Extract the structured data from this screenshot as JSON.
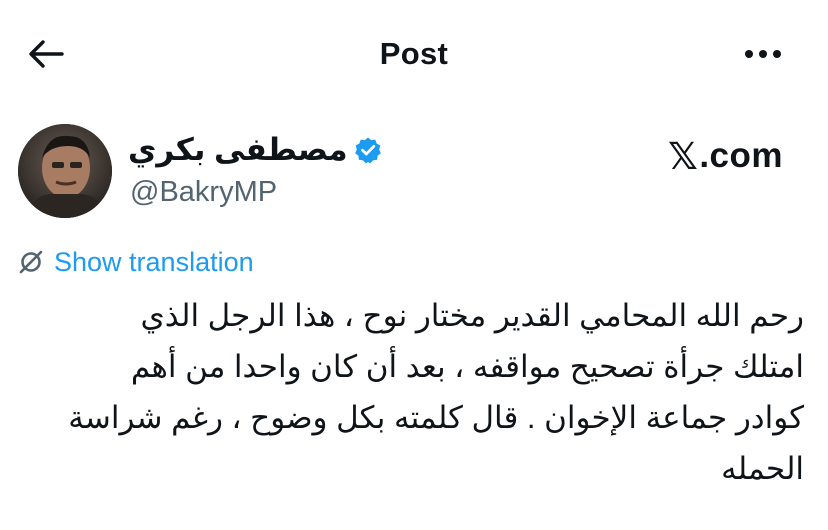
{
  "header": {
    "back_icon": "arrow-left-icon",
    "title": "Post",
    "more_icon": "more-horizontal-icon"
  },
  "author": {
    "name": "مصطفى بكري",
    "handle": "@BakryMP",
    "verified_icon": "verified-badge-icon",
    "verified_color": "#1d9bf0"
  },
  "watermark": {
    "x": "𝕏",
    "domain": ".com"
  },
  "translation": {
    "icon": "translate-icon",
    "label": "Show translation",
    "color": "#1d9bf0"
  },
  "tweet": {
    "lines": [
      "رحم الله المحامي القدير مختار نوح ، هذا الرجل الذي",
      "امتلك جرأة تصحيح مواقفه ، بعد أن كان واحدا من أهم",
      "كوادر جماعة الإخوان . قال كلمته بكل وضوح ، رغم شراسة",
      "الحمله"
    ]
  }
}
